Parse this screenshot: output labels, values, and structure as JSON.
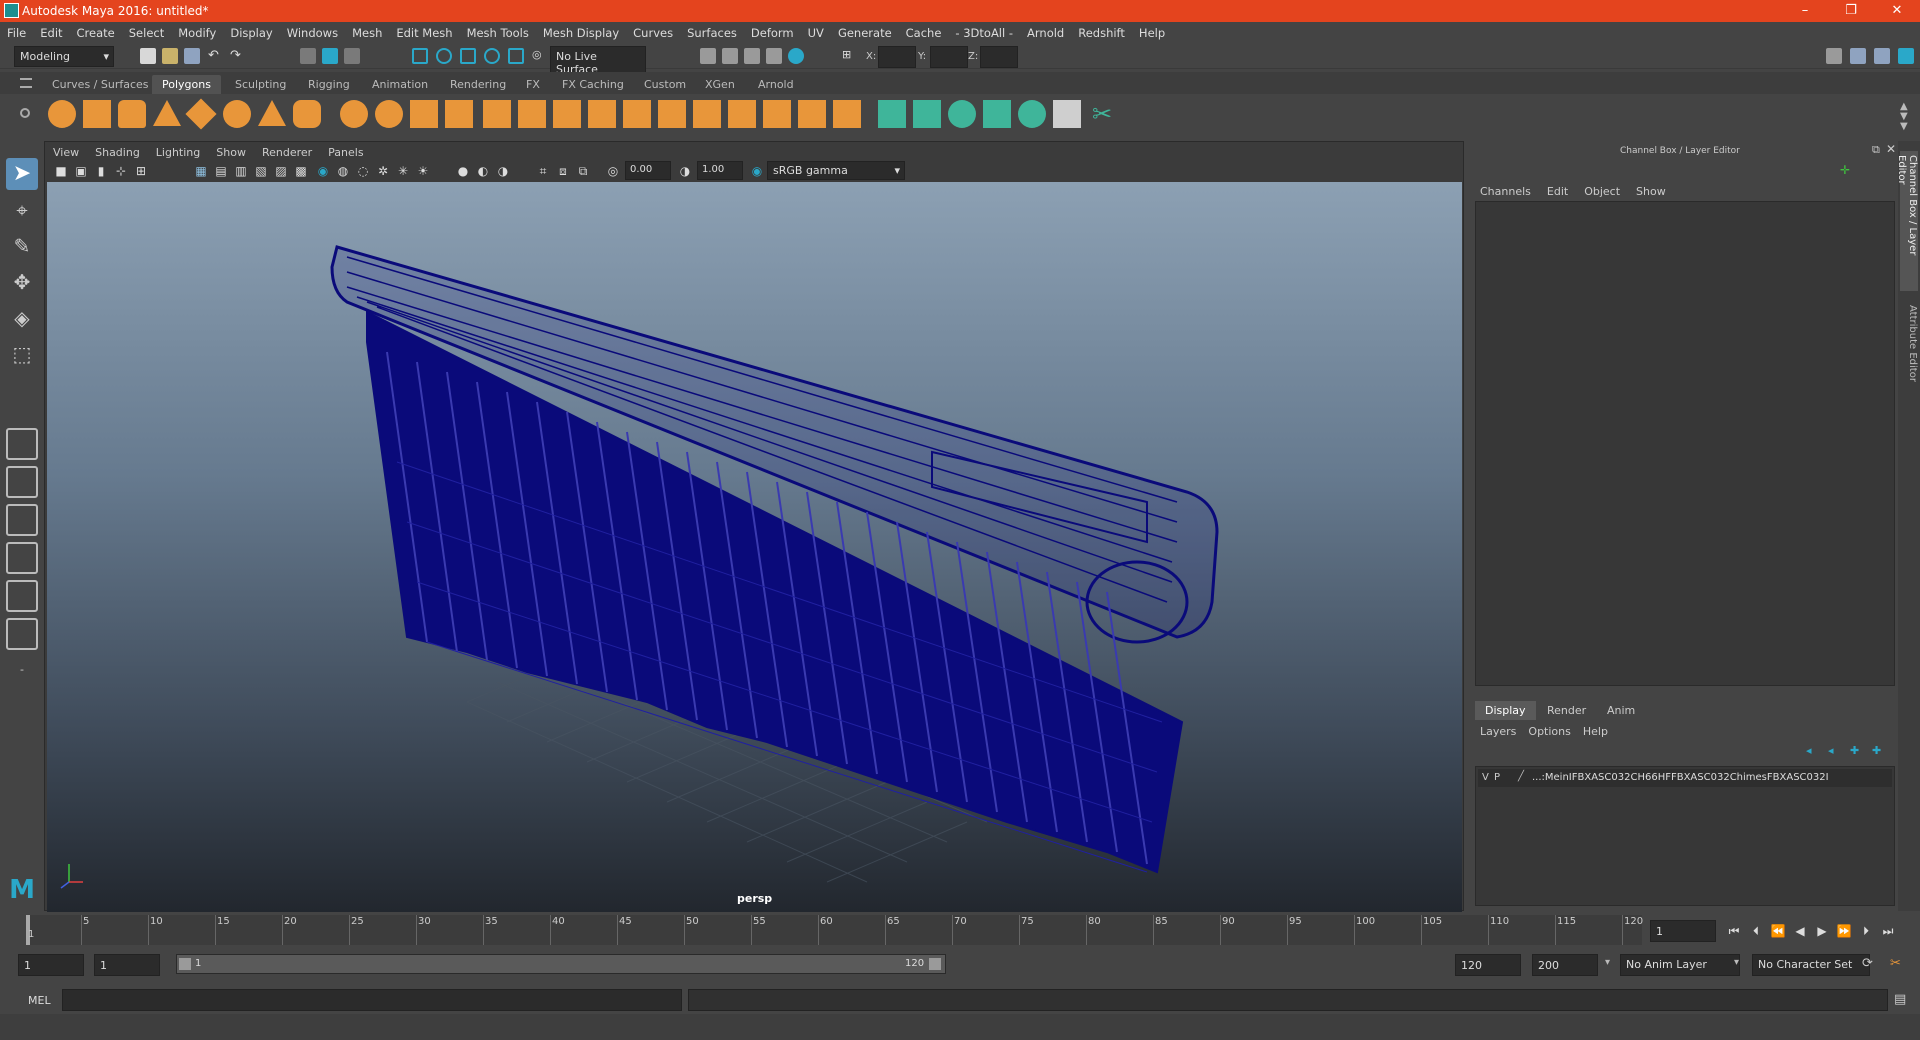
{
  "window": {
    "title": "Autodesk Maya 2016: untitled*",
    "controls": [
      "–",
      "❐",
      "✕"
    ]
  },
  "menubar": [
    "File",
    "Edit",
    "Create",
    "Select",
    "Modify",
    "Display",
    "Windows",
    "Mesh",
    "Edit Mesh",
    "Mesh Tools",
    "Mesh Display",
    "Curves",
    "Surfaces",
    "Deform",
    "UV",
    "Generate",
    "Cache",
    "- 3DtoAll -",
    "Arnold",
    "Redshift",
    "Help"
  ],
  "statusline": {
    "mode": "Modeling",
    "live_surface": "No Live Surface",
    "x_label": "X:",
    "y_label": "Y:",
    "z_label": "Z:"
  },
  "shelf_tabs": [
    "Curves / Surfaces",
    "Polygons",
    "Sculpting",
    "Rigging",
    "Animation",
    "Rendering",
    "FX",
    "FX Caching",
    "Custom",
    "XGen",
    "Arnold"
  ],
  "shelf_active_tab": "Polygons",
  "viewport": {
    "menus": [
      "View",
      "Shading",
      "Lighting",
      "Show",
      "Renderer",
      "Panels"
    ],
    "exposure": "0.00",
    "gamma": "1.00",
    "color_space": "sRGB gamma",
    "camera": "persp"
  },
  "channel_box": {
    "title": "Channel Box / Layer Editor",
    "menus": [
      "Channels",
      "Edit",
      "Object",
      "Show"
    ],
    "layer_tabs": [
      "Display",
      "Render",
      "Anim"
    ],
    "layer_menus": [
      "Layers",
      "Options",
      "Help"
    ],
    "layer_row": {
      "v": "V",
      "p": "P",
      "name": "...:MeinIFBXASC032CH66HFFBXASC032ChimesFBXASC032I"
    }
  },
  "side_tabs": [
    "Channel Box / Layer Editor",
    "Attribute Editor"
  ],
  "timeline": {
    "ticks": [
      "1",
      "5",
      "10",
      "15",
      "20",
      "25",
      "30",
      "35",
      "40",
      "45",
      "50",
      "55",
      "60",
      "65",
      "70",
      "75",
      "80",
      "85",
      "90",
      "95",
      "100",
      "105",
      "110",
      "115",
      "120"
    ],
    "current_frame": "1"
  },
  "range": {
    "start": "1",
    "anim_start": "1",
    "slider_start": "1",
    "slider_end": "120",
    "end": "120",
    "anim_end": "200",
    "anim_layer": "No Anim Layer",
    "character_set": "No Character Set"
  },
  "cmdline": {
    "lang": "MEL"
  },
  "colors": {
    "titlebar": "#e4441e",
    "wireframe": "#0a0a7a",
    "accent": "#2aa8c9"
  }
}
